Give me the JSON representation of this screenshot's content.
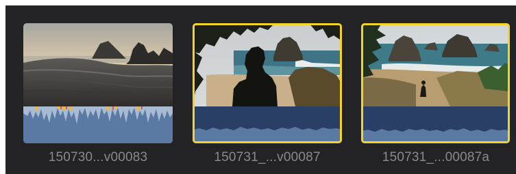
{
  "browser": {
    "clips": [
      {
        "name": "150730...v00083",
        "selected": false
      },
      {
        "name": "150731_...v00087",
        "selected": true
      },
      {
        "name": "150731_...00087a",
        "selected": true
      }
    ]
  },
  "colors": {
    "background": "#232325",
    "selection": "#f3d427",
    "waveform_fill": "#5a7aa3",
    "waveform_bg": "#2a3f66",
    "waveform_peak": "#f0b83a",
    "clipname": "#8a8a8f"
  }
}
